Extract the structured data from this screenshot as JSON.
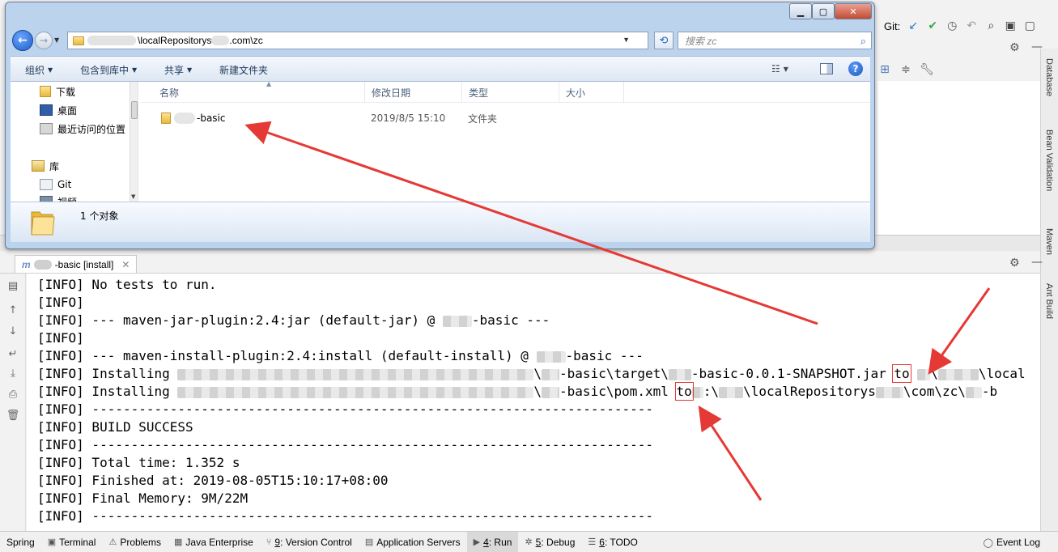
{
  "ide": {
    "git_label": "Git:",
    "right_tabs": [
      "Database",
      "Bean Validation",
      "Maven",
      "Ant Build"
    ]
  },
  "explorer": {
    "address": {
      "path_middle": "\\localRepositorys",
      "path_end": ".com\\zc"
    },
    "search_placeholder": "搜索 zc",
    "toolbar": {
      "organize": "组织",
      "include_in_library": "包含到库中",
      "share": "共享",
      "new_folder": "新建文件夹"
    },
    "nav_pane": {
      "downloads": "下载",
      "desktop": "桌面",
      "recent": "最近访问的位置",
      "libraries": "库",
      "git": "Git",
      "videos": "视频"
    },
    "columns": {
      "name": "名称",
      "modified": "修改日期",
      "type": "类型",
      "size": "大小"
    },
    "files": [
      {
        "name_suffix": "-basic",
        "modified": "2019/8/5 15:10",
        "type": "文件夹",
        "size": ""
      }
    ],
    "status": "1 个对象"
  },
  "run": {
    "tab_label": "-basic [install]",
    "console_lines": [
      "[INFO] No tests to run.",
      "[INFO]",
      "[INFO] --- maven-jar-plugin:2.4:jar (default-jar) @ ",
      "[INFO]",
      "[INFO] --- maven-install-plugin:2.4:install (default-install) @ ",
      "[INFO] Installing ",
      "[INFO] Installing ",
      "[INFO] ------------------------------------------------------------------------",
      "[INFO] BUILD SUCCESS",
      "[INFO] ------------------------------------------------------------------------",
      "[INFO] Total time: 1.352 s",
      "[INFO] Finished at: 2019-08-05T15:10:17+08:00",
      "[INFO] Final Memory: 9M/22M",
      "[INFO] ------------------------------------------------------------------------"
    ],
    "jar_line_parts": {
      "mid": "\\",
      "target": "-basic\\target\\",
      "jarname": "-basic-0.0.1-SNAPSHOT.jar ",
      "to": "to",
      "after": "\\",
      "local": "\\local"
    },
    "pom_line_parts": {
      "mid": "\\",
      "pom": "-basic\\pom.xml ",
      "to": "to",
      "drive": ":\\",
      "repo": "\\localRepositorys",
      "comzc": "\\com\\zc\\",
      "tail": "-b"
    },
    "basic_suffix": "-basic ---"
  },
  "statusbar": {
    "spring": "Spring",
    "terminal": "Terminal",
    "problems": "Problems",
    "java_enterprise": "Java Enterprise",
    "vc_num": "9",
    "vc_label": ": Version Control",
    "app_servers": "Application Servers",
    "run_num": "4",
    "run_label": ": Run",
    "debug_num": "5",
    "debug_label": ": Debug",
    "todo_num": "6",
    "todo_label": ": TODO",
    "event_log": "Event Log"
  },
  "colors": {
    "highlight_box": "#e53935",
    "arrow": "#e53935"
  }
}
